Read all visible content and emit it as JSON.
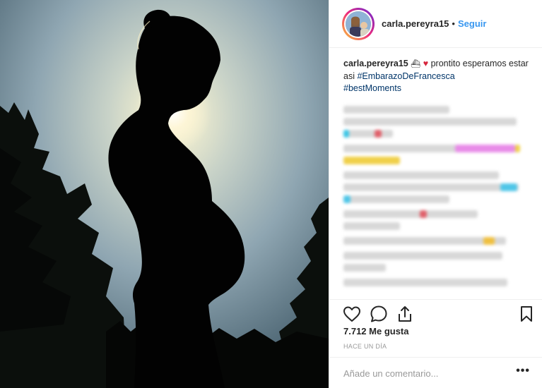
{
  "post": {
    "username": "carla.pereyra15",
    "follow_separator": "•",
    "follow_label": "Seguir"
  },
  "caption": {
    "username": "carla.pereyra15",
    "emoji": "⛴",
    "heart": "♥",
    "text": " prontito esperamos estar asi ",
    "hashtags": [
      "#EmbarazoDeFrancesca",
      "#bestMoments"
    ]
  },
  "stats": {
    "likes": "7.712 Me gusta",
    "timestamp": "HACE UN DÍA"
  },
  "comment_box": {
    "placeholder": "Añade un comentario...",
    "more": "•••"
  },
  "icons": {
    "like": "heart-icon",
    "comment": "comment-icon",
    "share": "share-icon",
    "save": "bookmark-icon"
  },
  "colors": {
    "link": "#3897f0",
    "hashtag": "#003569",
    "muted": "#999999",
    "text": "#262626",
    "border": "#efefef"
  }
}
